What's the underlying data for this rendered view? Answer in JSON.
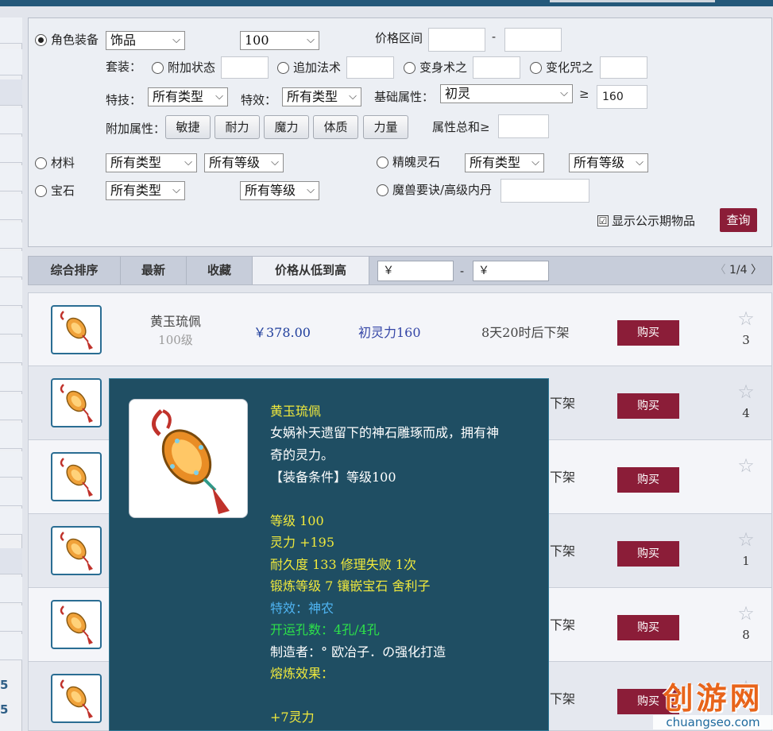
{
  "colors": {
    "accent": "#8b1d38",
    "top_bar": "#24587a",
    "price": "#1f3e9c",
    "tooltip_bg": "#1f4e63",
    "tooltip_yellow": "#f0e93c",
    "tooltip_blue": "#4fb4f2",
    "tooltip_green": "#2de04a"
  },
  "left_numbers": [
    "5",
    "5"
  ],
  "filter": {
    "role_equipment": {
      "label": "角色装备",
      "type_select": "饰品",
      "level_select": "100",
      "price_range_label": "价格区间",
      "price_dash": "-"
    },
    "suit": {
      "label": "套装：",
      "options": [
        "附加状态",
        "追加法术",
        "变身术之",
        "变化咒之"
      ]
    },
    "skill": {
      "label": "特技：",
      "select": "所有类型"
    },
    "effect": {
      "label": "特效：",
      "select": "所有类型"
    },
    "base_attr": {
      "label": "基础属性：",
      "select": "初灵",
      "ge_symbol": "≥",
      "value": "160"
    },
    "extra_attr": {
      "label": "附加属性：",
      "buttons": [
        "敏捷",
        "耐力",
        "魔力",
        "体质",
        "力量"
      ],
      "total_label": "属性总和≥"
    },
    "material": {
      "label": "材料",
      "type_select": "所有类型",
      "level_select": "所有等级"
    },
    "spirit_stone": {
      "label": "精魄灵石",
      "type_select": "所有类型",
      "level_select": "所有等级"
    },
    "gem": {
      "label": "宝石",
      "type_select": "所有类型",
      "level_select": "所有等级"
    },
    "beast_secret": {
      "label": "魔兽要诀/高级内丹"
    },
    "show_public": {
      "label": "显示公示期物品",
      "checked": "☑"
    },
    "query_button": "查询"
  },
  "sortbar": {
    "tabs": [
      "综合排序",
      "最新",
      "收藏",
      "价格从低到高"
    ],
    "yen_symbol": "￥",
    "dash": "-",
    "pager": {
      "prev": "〈",
      "text": "1/4",
      "next": "〉"
    }
  },
  "items": [
    {
      "name": "黄玉琉佩",
      "level": "100级",
      "price": "￥378.00",
      "attr": "初灵力160",
      "remaining": "8天20时后下架",
      "buy": "购买",
      "star": "☆",
      "count": "3"
    },
    {
      "remaining_tail": "下架",
      "buy": "购买",
      "star": "☆",
      "count": "4"
    },
    {
      "remaining_tail": "下架",
      "buy": "购买",
      "star": "☆",
      "count": ""
    },
    {
      "remaining_tail": "下架",
      "buy": "购买",
      "star": "☆",
      "count": "1"
    },
    {
      "remaining_tail": "下架",
      "buy": "购买",
      "star": "☆",
      "count": "8"
    },
    {
      "remaining_tail": "下架",
      "buy": "购买",
      "star": "☆",
      "count": ""
    }
  ],
  "tooltip": {
    "title": "黄玉琉佩",
    "desc_1": "女娲补天遗留下的神石雕琢而成，拥有神",
    "desc_2": "奇的灵力。",
    "requirement": "【装备条件】等级100",
    "level": "等级 100",
    "spirit": "灵力 +195",
    "durability": "耐久度 133 修理失败 1次",
    "forge": "锻炼等级 7 镶嵌宝石 舍利子",
    "special": "特效：神农",
    "holes": "开运孔数：4孔/4孔",
    "maker": "制造者：° 欧冶子．の强化打造",
    "smelt_label": "熔炼效果：",
    "smelt_value": "+7灵力"
  },
  "watermark": {
    "cn": "创游网",
    "en": "chuangseo.com"
  }
}
